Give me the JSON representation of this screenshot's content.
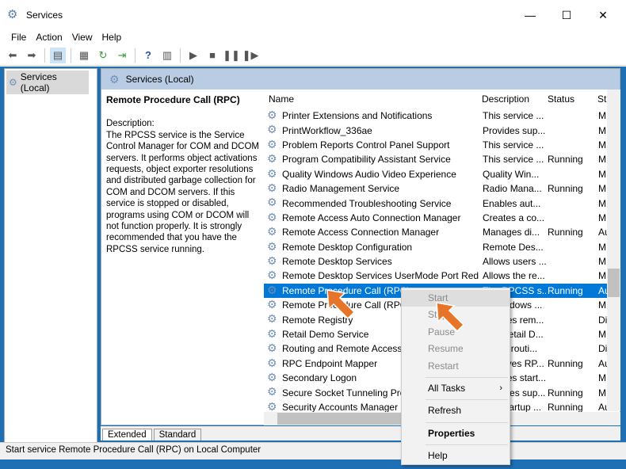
{
  "window": {
    "title": "Services",
    "minimize": "—",
    "maximize": "☐",
    "close": "✕"
  },
  "menu": [
    "File",
    "Action",
    "View",
    "Help"
  ],
  "tree": {
    "root": "Services (Local)"
  },
  "main": {
    "header": "Services (Local)"
  },
  "details": {
    "title": "Remote Procedure Call (RPC)",
    "label": "Description:",
    "text": "The RPCSS service is the Service Control Manager for COM and DCOM servers. It performs object activations requests, object exporter resolutions and distributed garbage collection for COM and DCOM servers. If this service is stopped or disabled, programs using COM or DCOM will not function properly. It is strongly recommended that you have the RPCSS service running."
  },
  "columns": {
    "name": "Name",
    "description": "Description",
    "status": "Status",
    "startup": "St"
  },
  "services": [
    {
      "name": "Printer Extensions and Notifications",
      "description": "This service ...",
      "status": "",
      "startup": "M"
    },
    {
      "name": "PrintWorkflow_336ae",
      "description": "Provides sup...",
      "status": "",
      "startup": "M"
    },
    {
      "name": "Problem Reports Control Panel Support",
      "description": "This service ...",
      "status": "",
      "startup": "M"
    },
    {
      "name": "Program Compatibility Assistant Service",
      "description": "This service ...",
      "status": "Running",
      "startup": "M"
    },
    {
      "name": "Quality Windows Audio Video Experience",
      "description": "Quality Win...",
      "status": "",
      "startup": "M"
    },
    {
      "name": "Radio Management Service",
      "description": "Radio Mana...",
      "status": "Running",
      "startup": "M"
    },
    {
      "name": "Recommended Troubleshooting Service",
      "description": "Enables aut...",
      "status": "",
      "startup": "M"
    },
    {
      "name": "Remote Access Auto Connection Manager",
      "description": "Creates a co...",
      "status": "",
      "startup": "M"
    },
    {
      "name": "Remote Access Connection Manager",
      "description": "Manages di...",
      "status": "Running",
      "startup": "Au"
    },
    {
      "name": "Remote Desktop Configuration",
      "description": "Remote Des...",
      "status": "",
      "startup": "M"
    },
    {
      "name": "Remote Desktop Services",
      "description": "Allows users ...",
      "status": "",
      "startup": "M"
    },
    {
      "name": "Remote Desktop Services UserMode Port Redir...",
      "description": "Allows the re...",
      "status": "",
      "startup": "M"
    },
    {
      "name": "Remote Procedure Call (RPC)",
      "description": "The RPCSS s...",
      "status": "Running",
      "startup": "Au"
    },
    {
      "name": "Remote Procedure Call (RPC) Locator",
      "description": "In Windows ...",
      "status": "",
      "startup": "M"
    },
    {
      "name": "Remote Registry",
      "description": "Enables rem...",
      "status": "",
      "startup": "Di"
    },
    {
      "name": "Retail Demo Service",
      "description": "The Retail D...",
      "status": "",
      "startup": "M"
    },
    {
      "name": "Routing and Remote Access",
      "description": "Offers routi...",
      "status": "",
      "startup": "Di"
    },
    {
      "name": "RPC Endpoint Mapper",
      "description": "Resolves RP...",
      "status": "Running",
      "startup": "Au"
    },
    {
      "name": "Secondary Logon",
      "description": "Enables start...",
      "status": "",
      "startup": "M"
    },
    {
      "name": "Secure Socket Tunneling Protocol Service",
      "description": "Provides sup...",
      "status": "Running",
      "startup": "M"
    },
    {
      "name": "Security Accounts Manager",
      "description": "The startup ...",
      "status": "Running",
      "startup": "Au"
    }
  ],
  "tabs": [
    "Extended",
    "Standard"
  ],
  "status_bar": "Start service Remote Procedure Call (RPC) on Local Computer",
  "context_menu": {
    "start": "Start",
    "stop": "Stop",
    "pause": "Pause",
    "resume": "Resume",
    "restart": "Restart",
    "all_tasks": "All Tasks",
    "refresh": "Refresh",
    "properties": "Properties",
    "help": "Help"
  },
  "colors": {
    "selection": "#0078d7",
    "frame": "#1f6fb5",
    "pointer_arrow": "#e8742a"
  }
}
